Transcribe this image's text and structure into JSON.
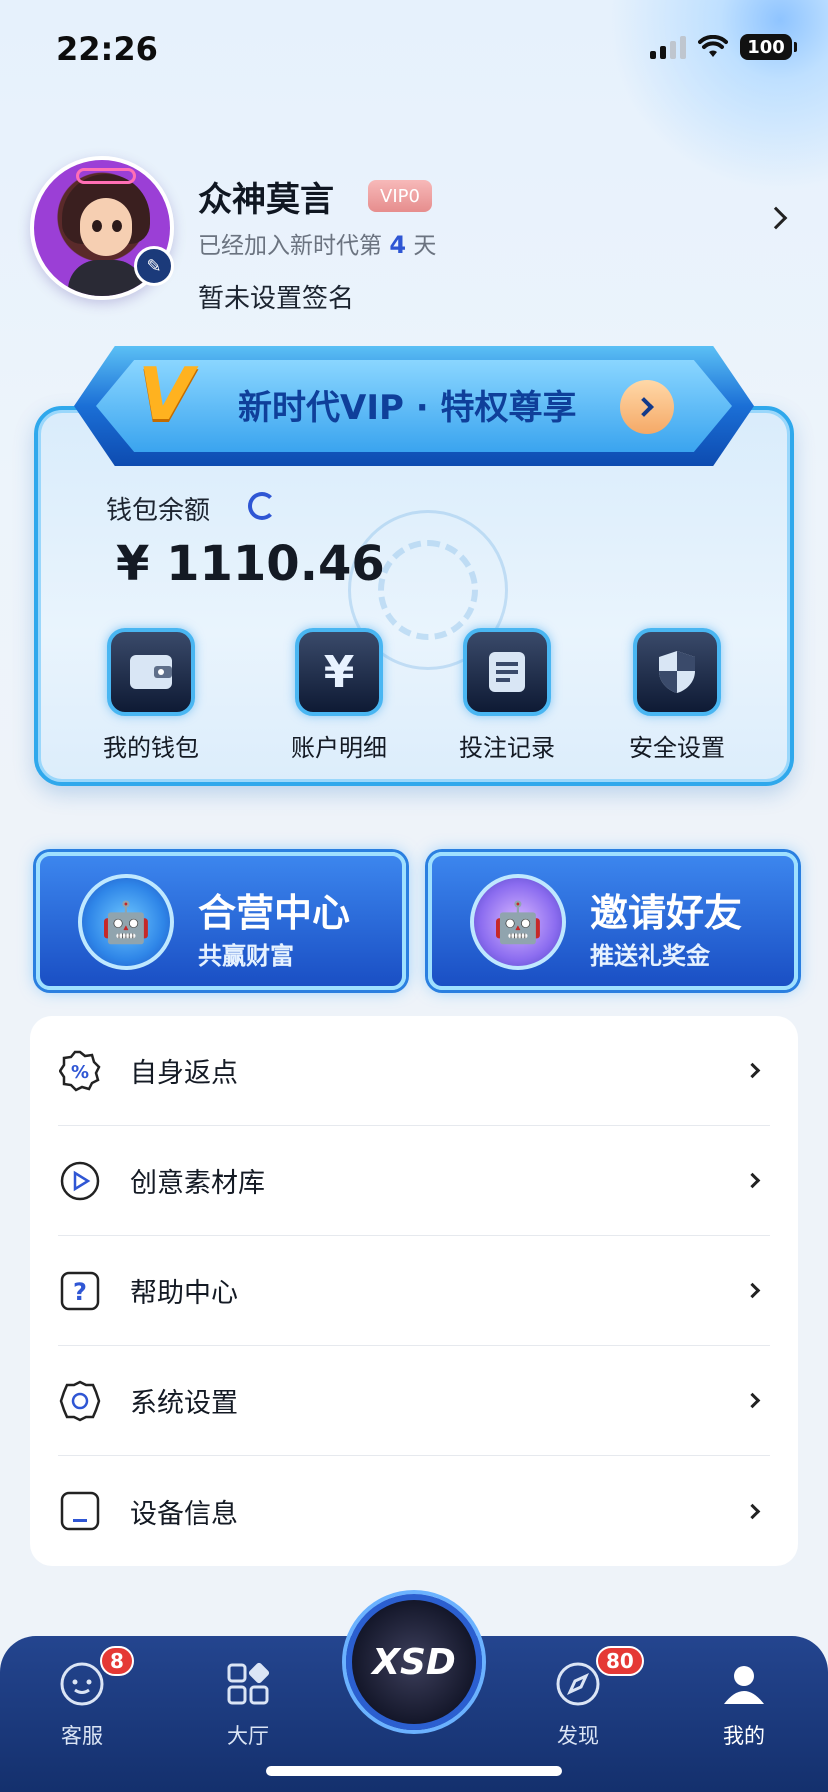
{
  "status_bar": {
    "time": "22:26",
    "battery": "100"
  },
  "profile": {
    "username": "众神莫言",
    "vip_level": "VIP0",
    "joined_prefix": "已经加入新时代第",
    "joined_days": "4",
    "joined_suffix": "天",
    "signature": "暂未设置签名"
  },
  "vip_banner": {
    "text": "新时代VIP · 特权尊享"
  },
  "wallet": {
    "label": "钱包余额",
    "balance": "¥ 1110.46",
    "actions": [
      {
        "label": "我的钱包",
        "icon": "wallet-icon"
      },
      {
        "label": "账户明细",
        "icon": "yen-icon"
      },
      {
        "label": "投注记录",
        "icon": "document-icon"
      },
      {
        "label": "安全设置",
        "icon": "shield-icon"
      }
    ]
  },
  "promos": [
    {
      "title": "合营中心",
      "subtitle": "共赢财富",
      "icon": "pirate-robot-icon"
    },
    {
      "title": "邀请好友",
      "subtitle": "推送礼奖金",
      "icon": "robot-icon"
    }
  ],
  "menu": [
    {
      "label": "自身返点",
      "icon": "percent-badge-icon"
    },
    {
      "label": "创意素材库",
      "icon": "play-circle-icon"
    },
    {
      "label": "帮助中心",
      "icon": "question-icon"
    },
    {
      "label": "系统设置",
      "icon": "gear-icon"
    },
    {
      "label": "设备信息",
      "icon": "device-icon"
    }
  ],
  "nav": {
    "items": [
      {
        "label": "客服",
        "badge": "8",
        "icon": "chat-face-icon"
      },
      {
        "label": "大厅",
        "badge": "",
        "icon": "grid-icon"
      },
      {
        "label": "发现",
        "badge": "80",
        "icon": "compass-icon"
      },
      {
        "label": "我的",
        "badge": "",
        "icon": "user-icon"
      }
    ],
    "center_logo": "XSD"
  },
  "colors": {
    "accent": "#2f56d4",
    "nav_bg": "#1c3a80",
    "badge": "#e53935"
  }
}
